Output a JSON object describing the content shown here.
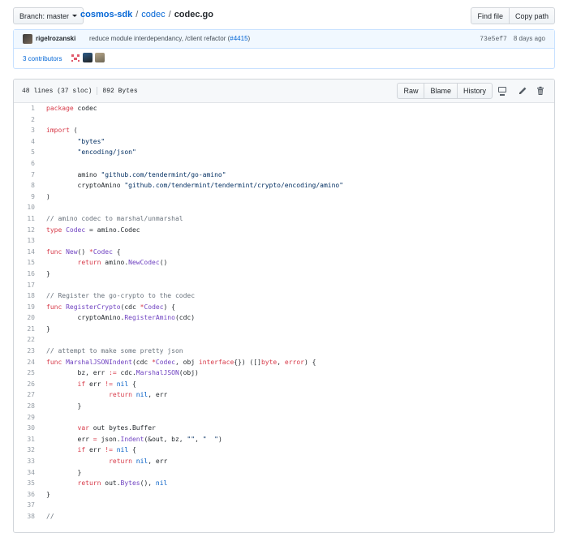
{
  "branch": {
    "label": "Branch: master"
  },
  "breadcrumb": {
    "repo": "cosmos-sdk",
    "dir": "codec",
    "file": "codec.go",
    "sep": "/"
  },
  "file_actions": {
    "find_file": "Find file",
    "copy_path": "Copy path"
  },
  "commit": {
    "author": "rigelrozanski",
    "message": "reduce module interdependancy, /client refactor (",
    "pr": "#4415",
    "message_end": ")",
    "sha": "73e5ef7",
    "time": "8 days ago",
    "contributors": "3 contributors"
  },
  "file_info": {
    "lines": "48 lines (37 sloc)",
    "size": "892 Bytes"
  },
  "view_actions": {
    "raw": "Raw",
    "blame": "Blame",
    "history": "History"
  },
  "icons": {
    "desktop": "desktop-icon",
    "edit": "pencil-icon",
    "delete": "trash-icon"
  },
  "colors": {
    "link": "#0366d6",
    "keyword": "#d73a49",
    "string": "#032f62",
    "comment": "#6a737d",
    "func": "#6f42c1",
    "const": "#005cc5"
  },
  "code_lines": [
    [
      [
        "k",
        "package"
      ],
      [
        "t",
        " codec"
      ]
    ],
    [],
    [
      [
        "k",
        "import"
      ],
      [
        "t",
        " ("
      ]
    ],
    [
      [
        "t",
        "        "
      ],
      [
        "s",
        "\"bytes\""
      ]
    ],
    [
      [
        "t",
        "        "
      ],
      [
        "s",
        "\"encoding/json\""
      ]
    ],
    [],
    [
      [
        "t",
        "        amino "
      ],
      [
        "s",
        "\"github.com/tendermint/go-amino\""
      ]
    ],
    [
      [
        "t",
        "        cryptoAmino "
      ],
      [
        "s",
        "\"github.com/tendermint/tendermint/crypto/encoding/amino\""
      ]
    ],
    [
      [
        "t",
        ")"
      ]
    ],
    [],
    [
      [
        "c",
        "// amino codec to marshal/unmarshal"
      ]
    ],
    [
      [
        "k",
        "type"
      ],
      [
        "t",
        " "
      ],
      [
        "f",
        "Codec"
      ],
      [
        "t",
        " = amino.Codec"
      ]
    ],
    [],
    [
      [
        "k",
        "func"
      ],
      [
        "t",
        " "
      ],
      [
        "f",
        "New"
      ],
      [
        "t",
        "() "
      ],
      [
        "k",
        "*"
      ],
      [
        "f",
        "Codec"
      ],
      [
        "t",
        " {"
      ]
    ],
    [
      [
        "t",
        "        "
      ],
      [
        "k",
        "return"
      ],
      [
        "t",
        " amino."
      ],
      [
        "f",
        "NewCodec"
      ],
      [
        "t",
        "()"
      ]
    ],
    [
      [
        "t",
        "}"
      ]
    ],
    [],
    [
      [
        "c",
        "// Register the go-crypto to the codec"
      ]
    ],
    [
      [
        "k",
        "func"
      ],
      [
        "t",
        " "
      ],
      [
        "f",
        "RegisterCrypto"
      ],
      [
        "t",
        "(cdc "
      ],
      [
        "k",
        "*"
      ],
      [
        "f",
        "Codec"
      ],
      [
        "t",
        ") {"
      ]
    ],
    [
      [
        "t",
        "        cryptoAmino."
      ],
      [
        "f",
        "RegisterAmino"
      ],
      [
        "t",
        "(cdc)"
      ]
    ],
    [
      [
        "t",
        "}"
      ]
    ],
    [],
    [
      [
        "c",
        "// attempt to make some pretty json"
      ]
    ],
    [
      [
        "k",
        "func"
      ],
      [
        "t",
        " "
      ],
      [
        "f",
        "MarshalJSONIndent"
      ],
      [
        "t",
        "(cdc "
      ],
      [
        "k",
        "*"
      ],
      [
        "f",
        "Codec"
      ],
      [
        "t",
        ", obj "
      ],
      [
        "k",
        "interface"
      ],
      [
        "t",
        "{}) ([]"
      ],
      [
        "k",
        "byte"
      ],
      [
        "t",
        ", "
      ],
      [
        "k",
        "error"
      ],
      [
        "t",
        ") {"
      ]
    ],
    [
      [
        "t",
        "        bz, err "
      ],
      [
        "k",
        ":="
      ],
      [
        "t",
        " cdc."
      ],
      [
        "f",
        "MarshalJSON"
      ],
      [
        "t",
        "(obj)"
      ]
    ],
    [
      [
        "t",
        "        "
      ],
      [
        "k",
        "if"
      ],
      [
        "t",
        " err "
      ],
      [
        "k",
        "!="
      ],
      [
        "t",
        " "
      ],
      [
        "n",
        "nil"
      ],
      [
        "t",
        " {"
      ]
    ],
    [
      [
        "t",
        "                "
      ],
      [
        "k",
        "return"
      ],
      [
        "t",
        " "
      ],
      [
        "n",
        "nil"
      ],
      [
        "t",
        ", err"
      ]
    ],
    [
      [
        "t",
        "        }"
      ]
    ],
    [],
    [
      [
        "t",
        "        "
      ],
      [
        "k",
        "var"
      ],
      [
        "t",
        " out bytes.Buffer"
      ]
    ],
    [
      [
        "t",
        "        err "
      ],
      [
        "k",
        "="
      ],
      [
        "t",
        " json."
      ],
      [
        "f",
        "Indent"
      ],
      [
        "t",
        "(&out, bz, "
      ],
      [
        "s",
        "\"\""
      ],
      [
        "t",
        ", "
      ],
      [
        "s",
        "\"  \""
      ],
      [
        "t",
        ")"
      ]
    ],
    [
      [
        "t",
        "        "
      ],
      [
        "k",
        "if"
      ],
      [
        "t",
        " err "
      ],
      [
        "k",
        "!="
      ],
      [
        "t",
        " "
      ],
      [
        "n",
        "nil"
      ],
      [
        "t",
        " {"
      ]
    ],
    [
      [
        "t",
        "                "
      ],
      [
        "k",
        "return"
      ],
      [
        "t",
        " "
      ],
      [
        "n",
        "nil"
      ],
      [
        "t",
        ", err"
      ]
    ],
    [
      [
        "t",
        "        }"
      ]
    ],
    [
      [
        "t",
        "        "
      ],
      [
        "k",
        "return"
      ],
      [
        "t",
        " out."
      ],
      [
        "f",
        "Bytes"
      ],
      [
        "t",
        "(), "
      ],
      [
        "n",
        "nil"
      ]
    ],
    [
      [
        "t",
        "}"
      ]
    ],
    [],
    [
      [
        "c",
        "//"
      ]
    ]
  ]
}
